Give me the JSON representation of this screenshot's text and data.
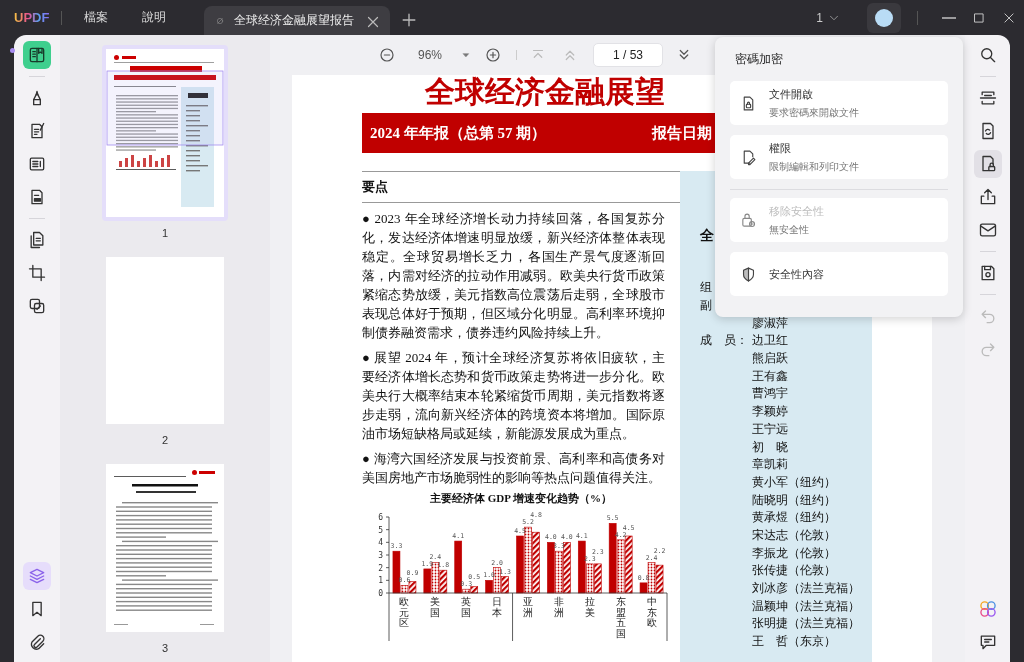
{
  "app": {
    "logo": "UPDF",
    "menu": [
      {
        "label": "檔案"
      },
      {
        "label": "說明"
      }
    ]
  },
  "tabs": [
    {
      "title": "全球经济金融展望报告",
      "selected": true
    }
  ],
  "window_count": "1",
  "left_tools": [
    {
      "kind": "reader",
      "selected": true
    },
    {
      "kind": "separator"
    },
    {
      "kind": "highlight",
      "selected": false
    },
    {
      "kind": "edit",
      "selected": false
    },
    {
      "kind": "form",
      "selected": false
    },
    {
      "kind": "fill-sign",
      "selected": false
    },
    {
      "kind": "separator"
    },
    {
      "kind": "organize",
      "selected": false
    },
    {
      "kind": "crop",
      "selected": false
    },
    {
      "kind": "compress",
      "selected": false
    }
  ],
  "left_bottom_tools": [
    {
      "kind": "layers",
      "selected": true
    },
    {
      "kind": "bookmark",
      "selected": false
    },
    {
      "kind": "attachment",
      "selected": false
    }
  ],
  "thumbnails": [
    {
      "page": "1",
      "kind": "cover",
      "selected": true
    },
    {
      "page": "2",
      "kind": "blank",
      "selected": false
    },
    {
      "page": "3",
      "kind": "text",
      "selected": false
    }
  ],
  "toolbar": {
    "zoom": "96%",
    "page": "1 / 53"
  },
  "document": {
    "title": "全球经济金融展望",
    "band_left": "2024 年年报（总第 57 期）",
    "band_right": "报告日期",
    "section": "要点",
    "paragraphs": [
      "● 2023 年全球经济增长动力持续回落，各国复苏分化，发达经济体增速明显放缓，新兴经济体整体表现稳定。全球贸易增长乏力，各国生产景气度逐渐回落，内需对经济的拉动作用减弱。欧美央行货币政策紧缩态势放缓，美元指数高位震荡后走弱，全球股市表现总体好于预期，但区域分化明显。高利率环境抑制债券融资需求，债券违约风险持续上升。",
      "● 展望 2024 年，预计全球经济复苏将依旧疲软，主要经济体增长态势和货币政策走势将进一步分化。欧美央行大概率结束本轮紧缩货币周期，美元指数将逐步走弱，流向新兴经济体的跨境资本将增加。国际原油市场短缺格局或延续，新能源发展成为重点。",
      "● 海湾六国经济发展与投资前景、高利率和高债务对美国房地产市场脆弱性的影响等热点问题值得关注。"
    ],
    "chart_data": {
      "type": "bar",
      "title": "主要经济体 GDP 增速变化趋势（%）",
      "categories": [
        "欧元区",
        "美国",
        "英国",
        "日本",
        "亚洲",
        "非洲",
        "拉美",
        "东盟五国",
        "中东欧"
      ],
      "series": [
        {
          "color": "#c00000",
          "values": [
            3.3,
            1.9,
            4.1,
            1.0,
            4.5,
            4.0,
            4.1,
            5.5,
            0.8
          ]
        },
        {
          "color": "#c00000",
          "values": [
            0.6,
            2.4,
            0.3,
            2.0,
            5.2,
            3.3,
            2.3,
            4.2,
            2.4
          ]
        },
        {
          "color": "#c00000",
          "values": [
            0.9,
            1.8,
            0.5,
            1.3,
            4.8,
            4.0,
            2.3,
            4.5,
            2.2
          ]
        }
      ],
      "ylim": [
        0,
        6
      ],
      "yticks": [
        0,
        1,
        2,
        3,
        4,
        5,
        6
      ],
      "value_labels": [
        [
          "3.3",
          "1.9",
          "4.1",
          "1.0",
          "4.5",
          "4.0",
          "4.1",
          "5.5",
          "0.8"
        ],
        [
          "0.6",
          "2.4",
          "0.3",
          "2.0",
          "5.2",
          "3.3",
          "2.3",
          "4.2",
          "2.4"
        ],
        [
          "0.9",
          "1.8",
          "0.5",
          "1.3",
          "4.8",
          "4.0",
          "2.3",
          "4.5",
          "2.2"
        ]
      ]
    },
    "sidebar": {
      "heading": "全",
      "rows": [
        {
          "label": "组"
        },
        {
          "label": "副"
        },
        {
          "name": "廖淑萍"
        },
        {
          "label": "成　员：",
          "name": "边卫红"
        },
        {
          "name": "熊启跃"
        },
        {
          "name": "王有鑫"
        },
        {
          "name": "曹鸿宇"
        },
        {
          "name": "李颖婷"
        },
        {
          "name": "王宁远"
        },
        {
          "name": "初　晓"
        },
        {
          "name": "章凯莉"
        },
        {
          "name": "黄小军（纽约）"
        },
        {
          "name": "陆晓明（纽约）"
        },
        {
          "name": "黄承煜（纽约）"
        },
        {
          "name": "宋达志（伦敦）"
        },
        {
          "name": "李振龙（伦敦）"
        },
        {
          "name": "张传捷（伦敦）"
        },
        {
          "name": "刘冰彦（法兰克福）"
        },
        {
          "name": "温颖坤（法兰克福）"
        },
        {
          "name": "张明捷（法兰克福）"
        },
        {
          "name": "王　哲（东京）"
        }
      ]
    }
  },
  "security_panel": {
    "title": "密碼加密",
    "options": [
      {
        "kind": "file-lock",
        "title": "文件開啟",
        "subtitle": "要求密碼來開啟文件",
        "disabled": false
      },
      {
        "kind": "file-edit",
        "title": "權限",
        "subtitle": "限制編輯和列印文件",
        "disabled": false
      },
      {
        "kind": "separator"
      },
      {
        "kind": "lock-remove",
        "title": "移除安全性",
        "subtitle": "無安全性",
        "disabled": true
      },
      {
        "kind": "shield",
        "title": "安全性內容",
        "disabled": false
      }
    ]
  },
  "right_tools": [
    {
      "kind": "search",
      "selected": false,
      "disabled": false
    },
    {
      "kind": "separator"
    },
    {
      "kind": "ocr",
      "selected": false,
      "disabled": false
    },
    {
      "kind": "convert",
      "selected": false,
      "disabled": false
    },
    {
      "kind": "protect",
      "selected": true,
      "disabled": false
    },
    {
      "kind": "share",
      "selected": false,
      "disabled": false
    },
    {
      "kind": "mail",
      "selected": false,
      "disabled": false
    },
    {
      "kind": "separator"
    },
    {
      "kind": "save",
      "selected": false,
      "disabled": false
    },
    {
      "kind": "separator"
    },
    {
      "kind": "undo",
      "selected": false,
      "disabled": true
    },
    {
      "kind": "redo",
      "selected": false,
      "disabled": true
    }
  ],
  "right_bottom_tools": [
    {
      "kind": "ai",
      "selected": false
    },
    {
      "kind": "comment",
      "selected": false
    }
  ]
}
